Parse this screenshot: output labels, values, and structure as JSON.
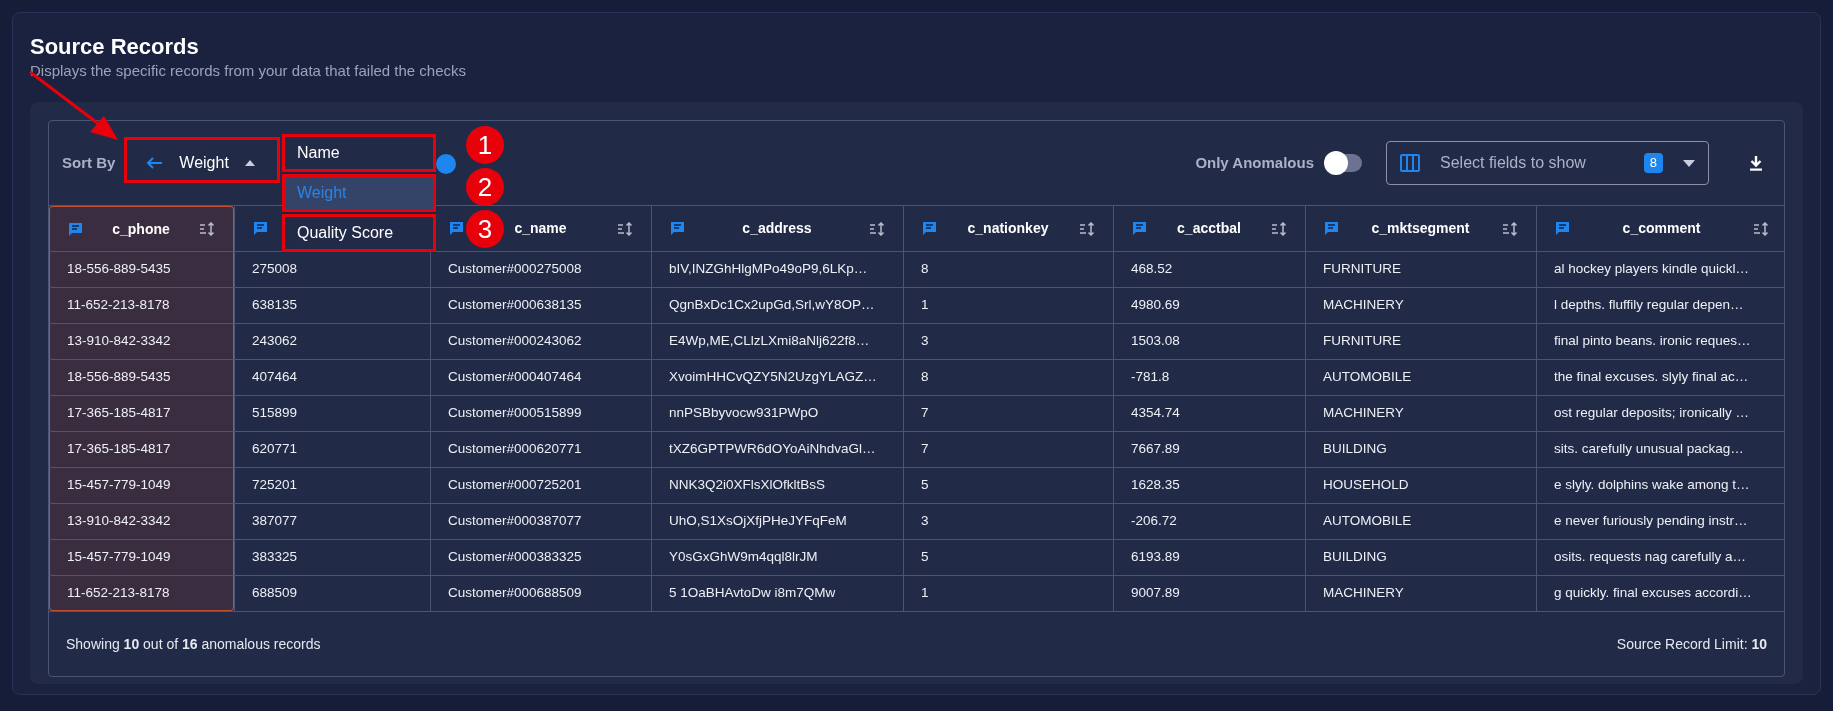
{
  "panel": {
    "title": "Source Records",
    "subtitle": "Displays the specific records from your data that failed the checks"
  },
  "toolbar": {
    "sort_label": "Sort By",
    "sort_value": "Weight",
    "only_anomalous_label": "Only Anomalous",
    "only_anomalous_on": false,
    "fields_placeholder": "Select fields to show",
    "fields_count": "8"
  },
  "sort_menu": [
    {
      "label": "Name",
      "selected": false
    },
    {
      "label": "Weight",
      "selected": true
    },
    {
      "label": "Quality Score",
      "selected": false
    }
  ],
  "annotation_markers": [
    {
      "label": "1"
    },
    {
      "label": "2"
    },
    {
      "label": "3"
    }
  ],
  "table": {
    "columns": [
      {
        "label": "c_phone",
        "highlighted": true
      },
      {
        "highlighted": false
      },
      {
        "label": "c_name",
        "highlighted": false
      },
      {
        "label": "c_address",
        "highlighted": false
      },
      {
        "label": "c_nationkey",
        "highlighted": false
      },
      {
        "label": "c_acctbal",
        "highlighted": false
      },
      {
        "label": "c_mktsegment",
        "highlighted": false
      },
      {
        "label": "c_comment",
        "highlighted": false
      }
    ],
    "rows": [
      [
        "18-556-889-5435",
        "275008",
        "Customer#000275008",
        "bIV,INZGhHlgMPo49oP9,6LKp…",
        "8",
        "468.52",
        "FURNITURE",
        "al hockey players kindle quickl…"
      ],
      [
        "11-652-213-8178",
        "638135",
        "Customer#000638135",
        "QgnBxDc1Cx2upGd,Srl,wY8OP…",
        "1",
        "4980.69",
        "MACHINERY",
        "l depths. fluffily regular depen…"
      ],
      [
        "13-910-842-3342",
        "243062",
        "Customer#000243062",
        "E4Wp,ME,CLlzLXmi8aNlj622f8…",
        "3",
        "1503.08",
        "FURNITURE",
        "final pinto beans. ironic reques…"
      ],
      [
        "18-556-889-5435",
        "407464",
        "Customer#000407464",
        "XvoimHHCvQZY5N2UzgYLAGZ…",
        "8",
        "-781.8",
        "AUTOMOBILE",
        "the final excuses. slyly final ac…"
      ],
      [
        "17-365-185-4817",
        "515899",
        "Customer#000515899",
        "nnPSBbyvocw931PWpO",
        "7",
        "4354.74",
        "MACHINERY",
        "ost regular deposits; ironically …"
      ],
      [
        "17-365-185-4817",
        "620771",
        "Customer#000620771",
        "tXZ6GPTPWR6dOYoAiNhdvaGl…",
        "7",
        "7667.89",
        "BUILDING",
        "sits. carefully unusual packag…"
      ],
      [
        "15-457-779-1049",
        "725201",
        "Customer#000725201",
        "NNK3Q2i0XFlsXlOfkltBsS",
        "5",
        "1628.35",
        "HOUSEHOLD",
        "e slyly. dolphins wake among t…"
      ],
      [
        "13-910-842-3342",
        "387077",
        "Customer#000387077",
        "UhO,S1XsOjXfjPHeJYFqFeM",
        "3",
        "-206.72",
        "AUTOMOBILE",
        "e never furiously pending instr…"
      ],
      [
        "15-457-779-1049",
        "383325",
        "Customer#000383325",
        "Y0sGxGhW9m4qql8lrJM",
        "5",
        "6193.89",
        "BUILDING",
        "osits. requests nag carefully a…"
      ],
      [
        "11-652-213-8178",
        "688509",
        "Customer#000688509",
        "5 1OaBHAvtoDw i8m7QMw",
        "1",
        "9007.89",
        "MACHINERY",
        "g quickly. final excuses accordi…"
      ]
    ]
  },
  "footer": {
    "summary": "Showing **10** out of **16** anomalous records",
    "limit": "Source Record Limit: **10**"
  }
}
